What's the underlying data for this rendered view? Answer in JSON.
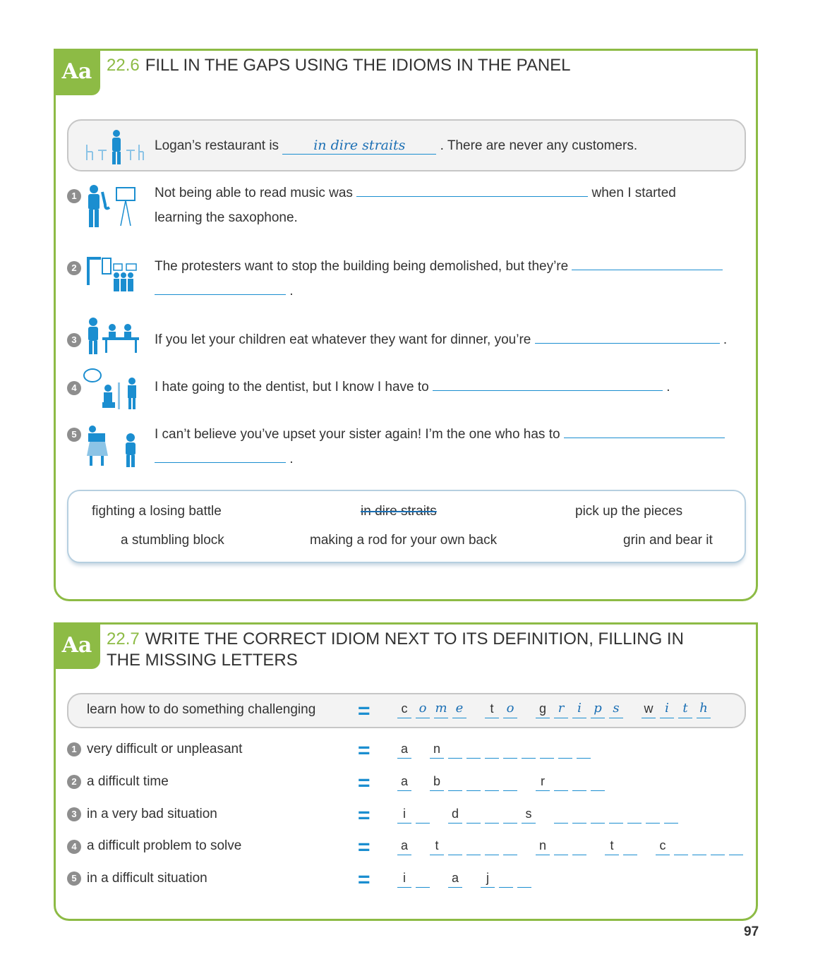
{
  "section1": {
    "badge": "Aa",
    "number": "22.6",
    "title": "FILL IN THE GAPS USING THE IDIOMS IN THE PANEL",
    "example": {
      "before": "Logan’s restaurant is",
      "answer": "in dire straits",
      "after": ". There are never any customers."
    },
    "items": [
      {
        "num": "1",
        "before": "Not being able to read music was",
        "after": "when I started",
        "line2": "learning the saxophone."
      },
      {
        "num": "2",
        "before": "The protesters want to stop the building being demolished, but they’re",
        "after": ""
      },
      {
        "num": "3",
        "before": "If you let your children eat whatever they want for dinner, you’re",
        "after": "."
      },
      {
        "num": "4",
        "before": "I hate going to the dentist, but I know I have to",
        "after": "."
      },
      {
        "num": "5",
        "before": "I can’t believe you’ve upset your sister again! I’m the one who has to",
        "after": ""
      }
    ],
    "line_end": ".",
    "panel": [
      "fighting a losing battle",
      "in dire straits",
      "pick up the pieces",
      "a stumbling block",
      "making a rod for your own back",
      "grin and bear it"
    ]
  },
  "section2": {
    "badge": "Aa",
    "number": "22.7",
    "title_line1": "WRITE THE CORRECT IDIOM NEXT TO ITS DEFINITION, FILLING IN",
    "title_line2": "THE MISSING LETTERS",
    "equals": "=",
    "example": {
      "definition": "learn how to do something challenging",
      "letters": [
        "c",
        "o",
        "m",
        "e",
        "t",
        "o",
        "g",
        "r",
        "i",
        "p",
        "s",
        "w",
        "i",
        "t",
        "h"
      ]
    },
    "items": [
      {
        "num": "1",
        "definition": "very difficult or unpleasant",
        "letters": [
          "a",
          "n",
          "",
          "",
          "",
          "",
          "",
          "",
          "",
          ""
        ]
      },
      {
        "num": "2",
        "definition": "a difficult time",
        "letters": [
          "a",
          "b",
          "",
          "",
          "",
          "",
          "r",
          "",
          "",
          ""
        ]
      },
      {
        "num": "3",
        "definition": "in a very bad situation",
        "letters": [
          "i",
          "",
          "d",
          "",
          "",
          "",
          "s",
          "",
          "",
          "",
          "",
          "",
          "",
          ""
        ]
      },
      {
        "num": "4",
        "definition": "a difficult problem to solve",
        "letters": [
          "a",
          "t",
          "",
          "",
          "",
          "",
          "n",
          "",
          "",
          "t",
          "",
          "c",
          "",
          "",
          "",
          ""
        ]
      },
      {
        "num": "5",
        "definition": "in a difficult situation",
        "letters": [
          "i",
          "",
          "a",
          "j",
          "",
          ""
        ]
      }
    ]
  },
  "page_number": "97"
}
